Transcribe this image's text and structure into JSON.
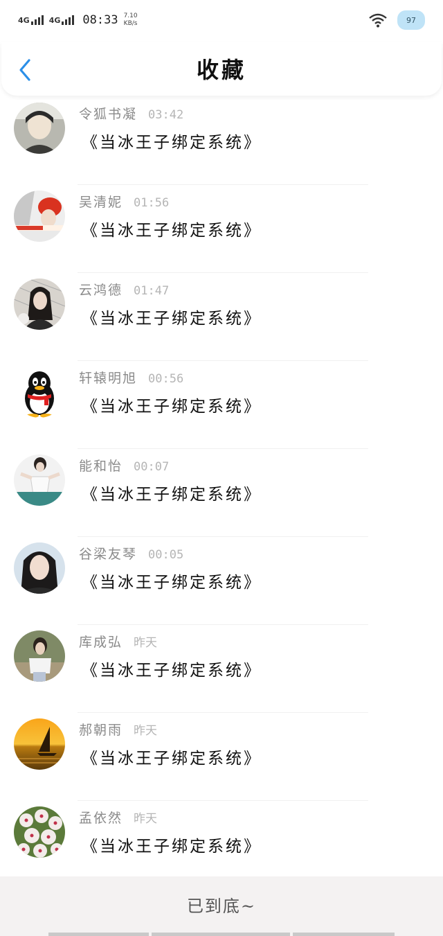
{
  "status": {
    "signal1": "4G",
    "signal2": "4G",
    "time": "08:33",
    "speed_value": "7.10",
    "speed_unit": "KB/s",
    "battery": "97"
  },
  "header": {
    "title": "收藏"
  },
  "items": [
    {
      "name": "令狐书凝",
      "time": "03:42",
      "title": "《当冰王子绑定系统》"
    },
    {
      "name": "吴清妮",
      "time": "01:56",
      "title": "《当冰王子绑定系统》"
    },
    {
      "name": "云鸿德",
      "time": "01:47",
      "title": "《当冰王子绑定系统》"
    },
    {
      "name": "轩辕明旭",
      "time": "00:56",
      "title": "《当冰王子绑定系统》"
    },
    {
      "name": "能和怡",
      "time": "00:07",
      "title": "《当冰王子绑定系统》"
    },
    {
      "name": "谷梁友琴",
      "time": "00:05",
      "title": "《当冰王子绑定系统》"
    },
    {
      "name": "库成弘",
      "time": "昨天",
      "title": "《当冰王子绑定系统》"
    },
    {
      "name": "郝朝雨",
      "time": "昨天",
      "title": "《当冰王子绑定系统》"
    },
    {
      "name": "孟依然",
      "time": "昨天",
      "title": "《当冰王子绑定系统》"
    }
  ],
  "footer": {
    "text": "已到底~"
  }
}
